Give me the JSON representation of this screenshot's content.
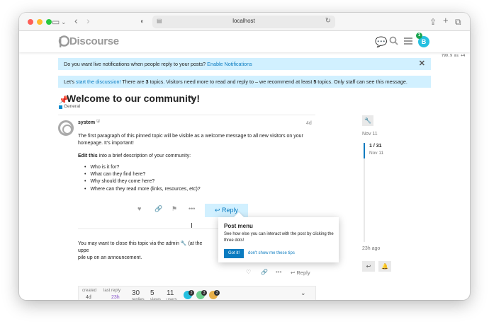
{
  "browser": {
    "url": "localhost"
  },
  "header": {
    "logo_text": "Discourse",
    "avatar_letter": "B",
    "notification_count": "1",
    "perf_readout": "799.9 ms +4"
  },
  "banners": {
    "notifications": {
      "text": "Do you want live notifications when people reply to your posts?",
      "link": "Enable Notifications"
    },
    "discussion": {
      "prefix": "Let's",
      "link": "start the discussion!",
      "text_a": " There are ",
      "topic_count": "3",
      "text_b": " topics. Visitors need more to read and reply to – we recommend at least ",
      "recommended": "5",
      "text_c": " topics. Only staff can see this message."
    }
  },
  "topic": {
    "title": "Welcome to our community!",
    "category": "General"
  },
  "post": {
    "username": "system",
    "age": "4d",
    "paragraph1": "The first paragraph of this pinned topic will be visible as a welcome message to all new visitors on your homepage. It's important!",
    "edit_bold": "Edit this",
    "edit_rest": " into a brief description of your community:",
    "bullets": [
      "Who is it for?",
      "What can they find here?",
      "Why should they come here?",
      "Where can they read more (links, resources, etc)?"
    ],
    "reply_label": "Reply"
  },
  "second_post": {
    "text_a": "You may want to close this topic via the admin",
    "text_b": "(at the uppe",
    "text_c": "pile up on an announcement.",
    "reply_label": "Reply"
  },
  "post_menu_tip": {
    "title": "Post menu",
    "body": "See how else you can interact with the post by clicking the three dots!",
    "got_it": "Got it!",
    "dont_show": "don't show me these tips"
  },
  "topic_map": {
    "created_label": "created",
    "created_value": "4d",
    "last_reply_label": "last reply",
    "last_reply_value": "23h",
    "replies": "30",
    "replies_label": "replies",
    "views": "5",
    "views_label": "views",
    "users": "11",
    "users_label": "users",
    "participant_counts": [
      "3",
      "3",
      "3"
    ]
  },
  "timeline": {
    "start_date": "Nov 11",
    "position": "1 / 31",
    "position_date": "Nov 11",
    "end_label": "23h ago"
  },
  "colors": {
    "accent": "#0a7bc0",
    "banner_bg": "#d1f0ff",
    "avatar": "#25c0e0"
  }
}
